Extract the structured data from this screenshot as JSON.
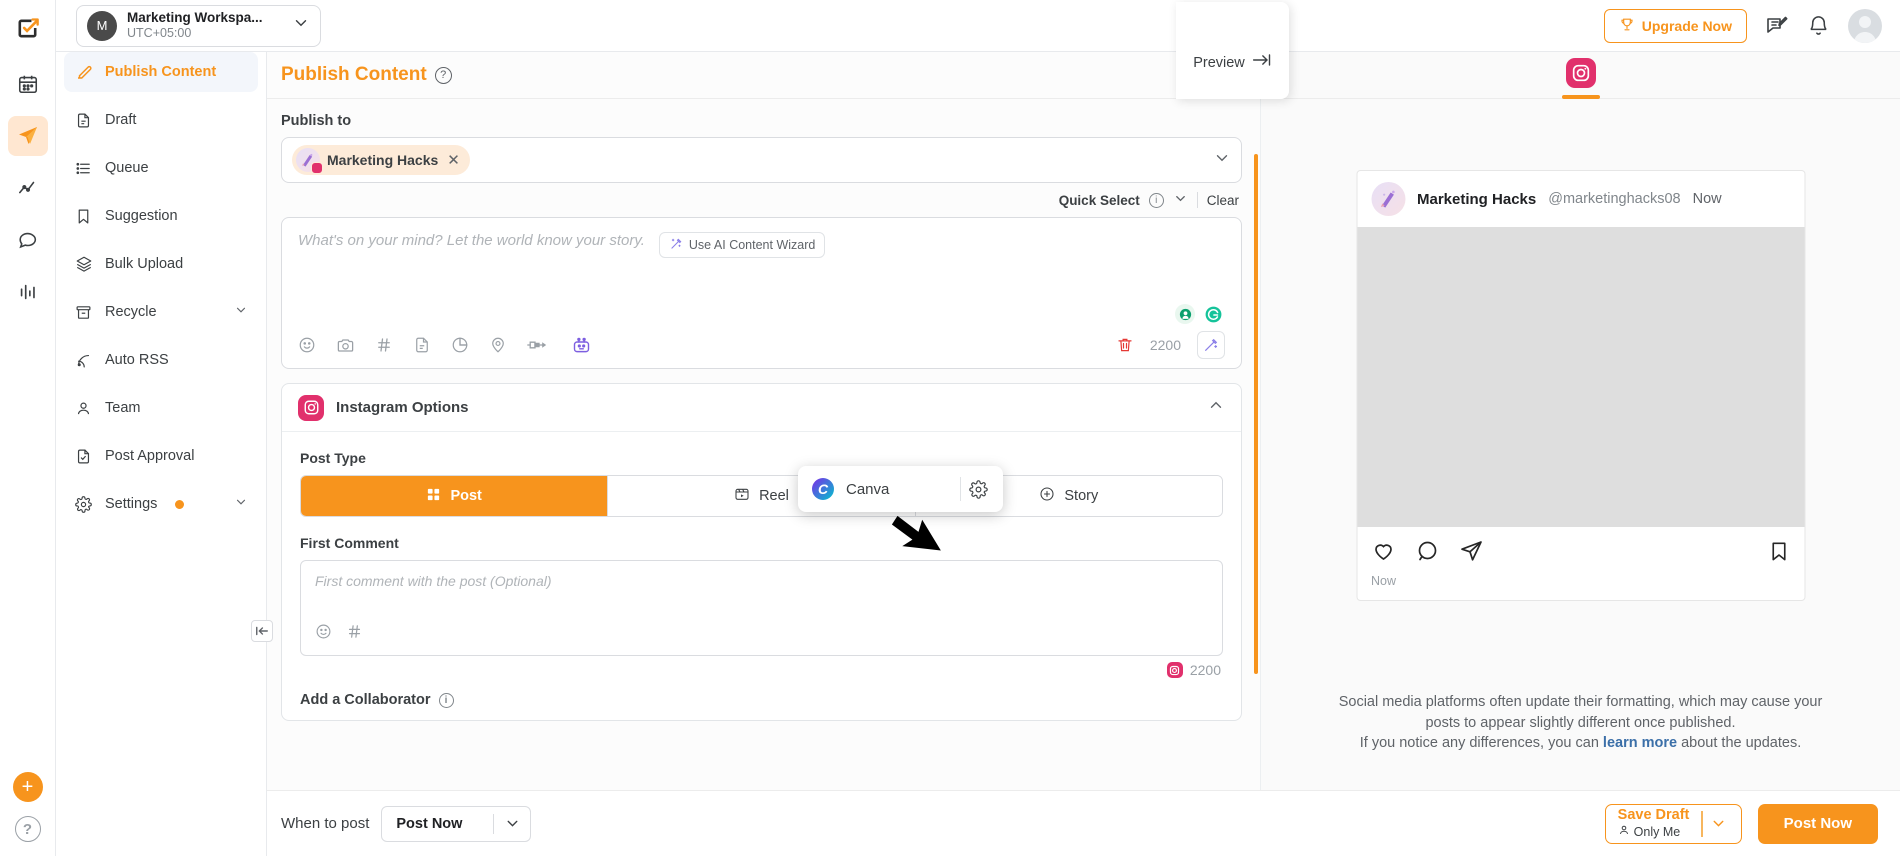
{
  "workspace": {
    "avatar_letter": "M",
    "name": "Marketing Workspa...",
    "timezone": "UTC+05:00"
  },
  "topbar": {
    "upgrade_label": "Upgrade Now",
    "icons": [
      "trophy-icon",
      "feedback-icon",
      "bell-icon",
      "user-avatar"
    ]
  },
  "rail": {
    "items": [
      "app-logo",
      "calendar-icon",
      "publish-icon",
      "analytics-icon",
      "engage-icon",
      "reports-icon"
    ],
    "plus_label": "+",
    "help_label": "?"
  },
  "sidebar": {
    "items": [
      {
        "label": "Publish Content",
        "icon": "pencil-icon",
        "active": true,
        "caret": false,
        "badge": false
      },
      {
        "label": "Draft",
        "icon": "document-icon",
        "active": false,
        "caret": false,
        "badge": false
      },
      {
        "label": "Queue",
        "icon": "list-icon",
        "active": false,
        "caret": false,
        "badge": false
      },
      {
        "label": "Suggestion",
        "icon": "bookmark-icon",
        "active": false,
        "caret": false,
        "badge": false
      },
      {
        "label": "Bulk Upload",
        "icon": "layers-icon",
        "active": false,
        "caret": false,
        "badge": false
      },
      {
        "label": "Recycle",
        "icon": "archive-icon",
        "active": false,
        "caret": true,
        "badge": false
      },
      {
        "label": "Auto RSS",
        "icon": "rss-icon",
        "active": false,
        "caret": false,
        "badge": false
      },
      {
        "label": "Team",
        "icon": "person-icon",
        "active": false,
        "caret": false,
        "badge": false
      },
      {
        "label": "Post Approval",
        "icon": "file-check-icon",
        "active": false,
        "caret": false,
        "badge": false
      },
      {
        "label": "Settings",
        "icon": "gear-icon",
        "active": false,
        "caret": true,
        "badge": true
      }
    ]
  },
  "page": {
    "title": "Publish Content",
    "help_icon": "question-icon"
  },
  "publish_to": {
    "label": "Publish to",
    "chip": {
      "name": "Marketing Hacks",
      "network": "instagram",
      "remove_icon": "close-icon"
    },
    "dropdown_icon": "chevron-down-icon",
    "quick_select_label": "Quick Select",
    "quick_select_info_icon": "info-icon",
    "clear_label": "Clear"
  },
  "composer": {
    "placeholder": "What's on your mind? Let the world know your story.",
    "ai_wizard_label": "Use AI Content Wizard",
    "toolbar_icons": [
      "emoji-icon",
      "camera-icon",
      "hashtag-icon",
      "template-icon",
      "poll-icon",
      "location-icon",
      "plug-icon",
      "bot-icon"
    ],
    "delete_icon": "trash-icon",
    "char_count": "2200",
    "wand_icon": "magic-wand-icon"
  },
  "canva_popup": {
    "label": "Canva",
    "icon": "canva-icon",
    "settings_icon": "gear-icon"
  },
  "instagram_options": {
    "title": "Instagram Options",
    "collapse_icon": "chevron-up-icon",
    "post_type_label": "Post Type",
    "post_types": [
      {
        "label": "Post",
        "icon": "grid-icon",
        "active": true
      },
      {
        "label": "Reel",
        "icon": "reel-icon",
        "active": false
      },
      {
        "label": "Story",
        "icon": "plus-circle-icon",
        "active": false
      }
    ],
    "first_comment_label": "First Comment",
    "first_comment_placeholder": "First comment with the post (Optional)",
    "first_comment_icons": [
      "emoji-icon",
      "hashtag-icon"
    ],
    "first_comment_count": "2200",
    "collaborator_label": "Add a Collaborator",
    "collaborator_info_icon": "info-icon"
  },
  "preview": {
    "tab_label": "Preview",
    "tab_arrow_icon": "arrow-right-icon",
    "network_tab": "instagram",
    "post": {
      "name": "Marketing Hacks",
      "handle": "@marketinghacks08",
      "time": "Now",
      "footer_time": "Now",
      "actions": [
        "heart-icon",
        "comment-icon",
        "share-icon",
        "bookmark-icon"
      ]
    },
    "disclaimer_line1": "Social media platforms often update their formatting, which may cause your",
    "disclaimer_line2": "posts to appear slightly different once published.",
    "disclaimer_line3_pre": "If you notice any differences, you can ",
    "disclaimer_link": "learn more",
    "disclaimer_line3_post": " about the updates."
  },
  "bottombar": {
    "when_label": "When to post",
    "when_value": "Post Now",
    "when_caret_icon": "chevron-down-icon",
    "save_draft_title": "Save Draft",
    "save_draft_sub": "Only Me",
    "save_draft_sub_icon": "person-icon",
    "save_draft_caret_icon": "chevron-down-icon",
    "post_now_label": "Post Now"
  },
  "colors": {
    "accent": "#f7941d",
    "instagram": "#e1306c",
    "link": "#3b6fa8"
  }
}
